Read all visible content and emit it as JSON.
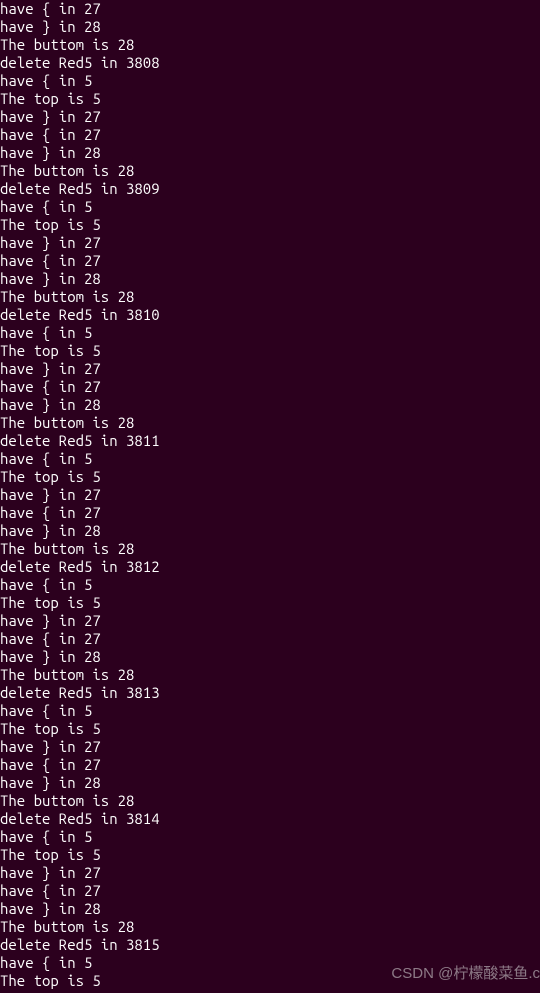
{
  "terminal": {
    "lines": [
      "have { in 27",
      "have } in 28",
      "The buttom is 28",
      "delete Red5 in 3808",
      "have { in 5",
      "The top is 5",
      "have } in 27",
      "have { in 27",
      "have } in 28",
      "The buttom is 28",
      "delete Red5 in 3809",
      "have { in 5",
      "The top is 5",
      "have } in 27",
      "have { in 27",
      "have } in 28",
      "The buttom is 28",
      "delete Red5 in 3810",
      "have { in 5",
      "The top is 5",
      "have } in 27",
      "have { in 27",
      "have } in 28",
      "The buttom is 28",
      "delete Red5 in 3811",
      "have { in 5",
      "The top is 5",
      "have } in 27",
      "have { in 27",
      "have } in 28",
      "The buttom is 28",
      "delete Red5 in 3812",
      "have { in 5",
      "The top is 5",
      "have } in 27",
      "have { in 27",
      "have } in 28",
      "The buttom is 28",
      "delete Red5 in 3813",
      "have { in 5",
      "The top is 5",
      "have } in 27",
      "have { in 27",
      "have } in 28",
      "The buttom is 28",
      "delete Red5 in 3814",
      "have { in 5",
      "The top is 5",
      "have } in 27",
      "have { in 27",
      "have } in 28",
      "The buttom is 28",
      "delete Red5 in 3815",
      "have { in 5",
      "The top is 5"
    ]
  },
  "watermark": {
    "text": "CSDN @柠檬酸菜鱼.c"
  }
}
